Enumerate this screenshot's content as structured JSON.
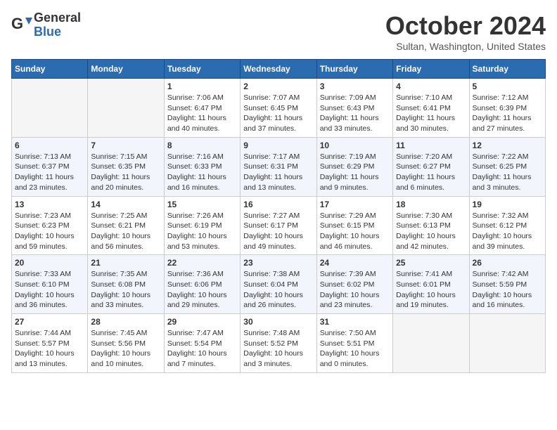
{
  "logo": {
    "general": "General",
    "blue": "Blue"
  },
  "title": "October 2024",
  "location": "Sultan, Washington, United States",
  "weekdays": [
    "Sunday",
    "Monday",
    "Tuesday",
    "Wednesday",
    "Thursday",
    "Friday",
    "Saturday"
  ],
  "weeks": [
    [
      {
        "day": "",
        "sunrise": "",
        "sunset": "",
        "daylight": "",
        "empty": true
      },
      {
        "day": "",
        "sunrise": "",
        "sunset": "",
        "daylight": "",
        "empty": true
      },
      {
        "day": "1",
        "sunrise": "Sunrise: 7:06 AM",
        "sunset": "Sunset: 6:47 PM",
        "daylight": "Daylight: 11 hours and 40 minutes."
      },
      {
        "day": "2",
        "sunrise": "Sunrise: 7:07 AM",
        "sunset": "Sunset: 6:45 PM",
        "daylight": "Daylight: 11 hours and 37 minutes."
      },
      {
        "day": "3",
        "sunrise": "Sunrise: 7:09 AM",
        "sunset": "Sunset: 6:43 PM",
        "daylight": "Daylight: 11 hours and 33 minutes."
      },
      {
        "day": "4",
        "sunrise": "Sunrise: 7:10 AM",
        "sunset": "Sunset: 6:41 PM",
        "daylight": "Daylight: 11 hours and 30 minutes."
      },
      {
        "day": "5",
        "sunrise": "Sunrise: 7:12 AM",
        "sunset": "Sunset: 6:39 PM",
        "daylight": "Daylight: 11 hours and 27 minutes."
      }
    ],
    [
      {
        "day": "6",
        "sunrise": "Sunrise: 7:13 AM",
        "sunset": "Sunset: 6:37 PM",
        "daylight": "Daylight: 11 hours and 23 minutes."
      },
      {
        "day": "7",
        "sunrise": "Sunrise: 7:15 AM",
        "sunset": "Sunset: 6:35 PM",
        "daylight": "Daylight: 11 hours and 20 minutes."
      },
      {
        "day": "8",
        "sunrise": "Sunrise: 7:16 AM",
        "sunset": "Sunset: 6:33 PM",
        "daylight": "Daylight: 11 hours and 16 minutes."
      },
      {
        "day": "9",
        "sunrise": "Sunrise: 7:17 AM",
        "sunset": "Sunset: 6:31 PM",
        "daylight": "Daylight: 11 hours and 13 minutes."
      },
      {
        "day": "10",
        "sunrise": "Sunrise: 7:19 AM",
        "sunset": "Sunset: 6:29 PM",
        "daylight": "Daylight: 11 hours and 9 minutes."
      },
      {
        "day": "11",
        "sunrise": "Sunrise: 7:20 AM",
        "sunset": "Sunset: 6:27 PM",
        "daylight": "Daylight: 11 hours and 6 minutes."
      },
      {
        "day": "12",
        "sunrise": "Sunrise: 7:22 AM",
        "sunset": "Sunset: 6:25 PM",
        "daylight": "Daylight: 11 hours and 3 minutes."
      }
    ],
    [
      {
        "day": "13",
        "sunrise": "Sunrise: 7:23 AM",
        "sunset": "Sunset: 6:23 PM",
        "daylight": "Daylight: 10 hours and 59 minutes."
      },
      {
        "day": "14",
        "sunrise": "Sunrise: 7:25 AM",
        "sunset": "Sunset: 6:21 PM",
        "daylight": "Daylight: 10 hours and 56 minutes."
      },
      {
        "day": "15",
        "sunrise": "Sunrise: 7:26 AM",
        "sunset": "Sunset: 6:19 PM",
        "daylight": "Daylight: 10 hours and 53 minutes."
      },
      {
        "day": "16",
        "sunrise": "Sunrise: 7:27 AM",
        "sunset": "Sunset: 6:17 PM",
        "daylight": "Daylight: 10 hours and 49 minutes."
      },
      {
        "day": "17",
        "sunrise": "Sunrise: 7:29 AM",
        "sunset": "Sunset: 6:15 PM",
        "daylight": "Daylight: 10 hours and 46 minutes."
      },
      {
        "day": "18",
        "sunrise": "Sunrise: 7:30 AM",
        "sunset": "Sunset: 6:13 PM",
        "daylight": "Daylight: 10 hours and 42 minutes."
      },
      {
        "day": "19",
        "sunrise": "Sunrise: 7:32 AM",
        "sunset": "Sunset: 6:12 PM",
        "daylight": "Daylight: 10 hours and 39 minutes."
      }
    ],
    [
      {
        "day": "20",
        "sunrise": "Sunrise: 7:33 AM",
        "sunset": "Sunset: 6:10 PM",
        "daylight": "Daylight: 10 hours and 36 minutes."
      },
      {
        "day": "21",
        "sunrise": "Sunrise: 7:35 AM",
        "sunset": "Sunset: 6:08 PM",
        "daylight": "Daylight: 10 hours and 33 minutes."
      },
      {
        "day": "22",
        "sunrise": "Sunrise: 7:36 AM",
        "sunset": "Sunset: 6:06 PM",
        "daylight": "Daylight: 10 hours and 29 minutes."
      },
      {
        "day": "23",
        "sunrise": "Sunrise: 7:38 AM",
        "sunset": "Sunset: 6:04 PM",
        "daylight": "Daylight: 10 hours and 26 minutes."
      },
      {
        "day": "24",
        "sunrise": "Sunrise: 7:39 AM",
        "sunset": "Sunset: 6:02 PM",
        "daylight": "Daylight: 10 hours and 23 minutes."
      },
      {
        "day": "25",
        "sunrise": "Sunrise: 7:41 AM",
        "sunset": "Sunset: 6:01 PM",
        "daylight": "Daylight: 10 hours and 19 minutes."
      },
      {
        "day": "26",
        "sunrise": "Sunrise: 7:42 AM",
        "sunset": "Sunset: 5:59 PM",
        "daylight": "Daylight: 10 hours and 16 minutes."
      }
    ],
    [
      {
        "day": "27",
        "sunrise": "Sunrise: 7:44 AM",
        "sunset": "Sunset: 5:57 PM",
        "daylight": "Daylight: 10 hours and 13 minutes."
      },
      {
        "day": "28",
        "sunrise": "Sunrise: 7:45 AM",
        "sunset": "Sunset: 5:56 PM",
        "daylight": "Daylight: 10 hours and 10 minutes."
      },
      {
        "day": "29",
        "sunrise": "Sunrise: 7:47 AM",
        "sunset": "Sunset: 5:54 PM",
        "daylight": "Daylight: 10 hours and 7 minutes."
      },
      {
        "day": "30",
        "sunrise": "Sunrise: 7:48 AM",
        "sunset": "Sunset: 5:52 PM",
        "daylight": "Daylight: 10 hours and 3 minutes."
      },
      {
        "day": "31",
        "sunrise": "Sunrise: 7:50 AM",
        "sunset": "Sunset: 5:51 PM",
        "daylight": "Daylight: 10 hours and 0 minutes."
      },
      {
        "day": "",
        "sunrise": "",
        "sunset": "",
        "daylight": "",
        "empty": true
      },
      {
        "day": "",
        "sunrise": "",
        "sunset": "",
        "daylight": "",
        "empty": true
      }
    ]
  ]
}
